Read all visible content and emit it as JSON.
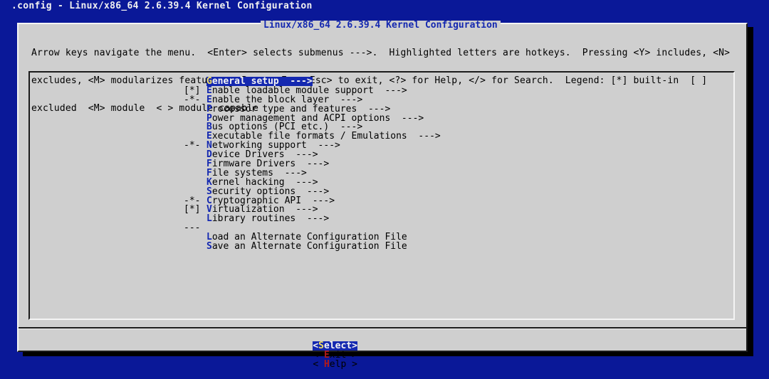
{
  "window": {
    "title": ".config - Linux/x86_64 2.6.39.4 Kernel Configuration"
  },
  "dialog": {
    "title": "Linux/x86_64 2.6.39.4 Kernel Configuration",
    "instructions": [
      "Arrow keys navigate the menu.  <Enter> selects submenus --->.  Highlighted letters are hotkeys.  Pressing <Y> includes, <N>",
      "excludes, <M> modularizes features.  Press <Esc><Esc> to exit, <?> for Help, </> for Search.  Legend: [*] built-in  [ ]",
      "excluded  <M> module  < > module capable"
    ]
  },
  "menu": {
    "items": [
      {
        "prefix": "",
        "hotkey": "G",
        "rest": "eneral setup  --->",
        "selected": true
      },
      {
        "prefix": "[*]",
        "hotkey": "E",
        "rest": "nable loadable module support  --->"
      },
      {
        "prefix": "-*-",
        "hotkey": "E",
        "rest": "nable the block layer  --->"
      },
      {
        "prefix": "",
        "hotkey": "P",
        "rest": "rocessor type and features  --->"
      },
      {
        "prefix": "",
        "hotkey": "P",
        "rest": "ower management and ACPI options  --->"
      },
      {
        "prefix": "",
        "hotkey": "B",
        "rest": "us options (PCI etc.)  --->"
      },
      {
        "prefix": "",
        "hotkey": "E",
        "rest": "xecutable file formats / Emulations  --->"
      },
      {
        "prefix": "-*-",
        "hotkey": "N",
        "rest": "etworking support  --->"
      },
      {
        "prefix": "",
        "hotkey": "D",
        "rest": "evice Drivers  --->"
      },
      {
        "prefix": "",
        "hotkey": "F",
        "rest": "irmware Drivers  --->"
      },
      {
        "prefix": "",
        "hotkey": "F",
        "rest": "ile systems  --->"
      },
      {
        "prefix": "",
        "hotkey": "K",
        "rest": "ernel hacking  --->"
      },
      {
        "prefix": "",
        "hotkey": "S",
        "rest": "ecurity options  --->"
      },
      {
        "prefix": "-*-",
        "hotkey": "C",
        "rest": "ryptographic API  --->"
      },
      {
        "prefix": "[*]",
        "hotkey": "V",
        "rest": "irtualization  --->"
      },
      {
        "prefix": "",
        "hotkey": "L",
        "rest": "ibrary routines  --->"
      }
    ],
    "separator": "---",
    "extra_items": [
      {
        "hotkey": "L",
        "rest": "oad an Alternate Configuration File"
      },
      {
        "hotkey": "S",
        "rest": "ave an Alternate Configuration File"
      }
    ]
  },
  "buttons": {
    "select": {
      "open": "<",
      "hotkey": "S",
      "rest": "elect",
      "close": ">"
    },
    "exit": {
      "open": "< ",
      "hotkey": "E",
      "rest": "xit",
      "close": " >"
    },
    "help": {
      "open": "< ",
      "hotkey": "H",
      "rest": "elp",
      "close": " >"
    }
  },
  "colors": {
    "background": "#0a1898",
    "dialog": "#cfcfcf",
    "accent": "#1428b0",
    "hotkey_button": "#b01a1a",
    "hotkey_selected": "#f4e060"
  }
}
